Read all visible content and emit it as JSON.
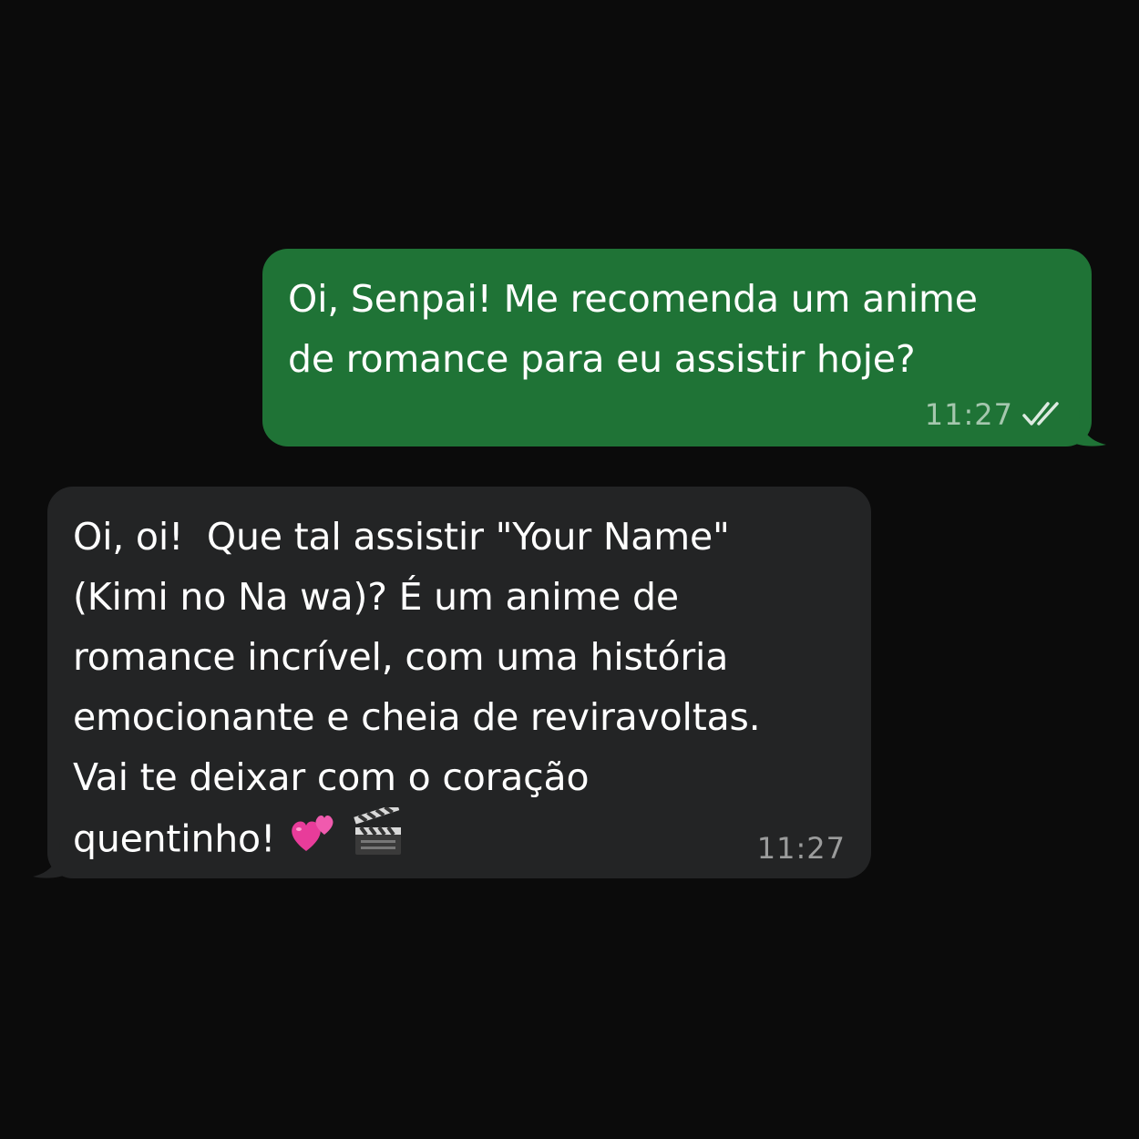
{
  "messages": [
    {
      "direction": "outgoing",
      "lines": [
        "Oi, Senpai! Me recomenda um anime",
        "de romance para eu assistir hoje?"
      ],
      "time": "11:27",
      "status_icon": "double-check-icon",
      "bubble_color": "#1f7336"
    },
    {
      "direction": "incoming",
      "lines": [
        "Oi, oi!  Que tal assistir \"Your Name\"",
        "(Kimi no Na wa)? É um anime de",
        "romance incrível, com uma história",
        "emocionante e cheia de reviravoltas.",
        "Vai te deixar com o coração",
        "quentinho!"
      ],
      "emojis": [
        "two-hearts-icon",
        "clapper-board-icon"
      ],
      "time": "11:27",
      "bubble_color": "#232425"
    }
  ]
}
